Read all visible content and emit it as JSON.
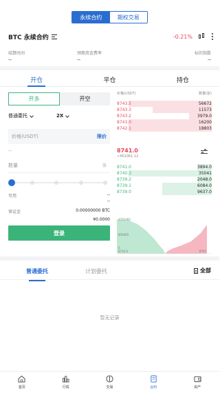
{
  "top_tabs": {
    "perpetual": "永续合约",
    "options": "期权交易"
  },
  "pair": {
    "name": "BTC 永续合约",
    "change": "-0.21%"
  },
  "info": {
    "labels": [
      "结算时间",
      "预期资金费率",
      "标的指数"
    ],
    "values": [
      "--",
      "--",
      "--"
    ]
  },
  "main_tabs": [
    "开仓",
    "平仓",
    "持仓"
  ],
  "trade": {
    "long_label": "开多",
    "short_label": "开空",
    "order_type": "普通委托",
    "leverage": "2X",
    "price_placeholder": "价格(USDT)",
    "limit_label": "限价",
    "approx": "--",
    "qty_placeholder": "数量",
    "qty_unit": "张",
    "slider_percent": 0,
    "available_label": "可用",
    "available_value": "--",
    "available_value2": "--",
    "margin_label": "保证金",
    "margin_value": "0.00000000 BTC",
    "margin_value2": "¥0.0000",
    "login_label": "登录"
  },
  "orderbook": {
    "price_header": "价格(USDT)",
    "qty_header": "数量(张)",
    "asks": [
      {
        "price": "8743.5",
        "qty": "56672",
        "depth": 0.88
      },
      {
        "price": "8743.3",
        "qty": "11573",
        "depth": 0.62
      },
      {
        "price": "8743.2",
        "qty": "3979.0",
        "depth": 0.24
      },
      {
        "price": "8743.0",
        "qty": "16200",
        "depth": 0.88
      },
      {
        "price": "8742.1",
        "qty": "18803",
        "depth": 0.88
      }
    ],
    "last_price": "8741.0",
    "last_sub": "≈¥61061.12",
    "bids": [
      {
        "price": "8741.0",
        "qty": "3894.0",
        "depth": 0.15
      },
      {
        "price": "8740.3",
        "qty": "35041",
        "depth": 0.88
      },
      {
        "price": "8739.2",
        "qty": "2048.0",
        "depth": 0.15
      },
      {
        "price": "8739.1",
        "qty": "6084.0",
        "depth": 0.52
      },
      {
        "price": "8739.0",
        "qty": "9637.0",
        "depth": 0.52
      }
    ],
    "depth_labels": {
      "y_top": "1701082",
      "y_mid": "850405",
      "y_bottom": "0",
      "x_left": "8733.0",
      "x_right": "8701"
    }
  },
  "order_tabs": {
    "normal": "普通委托",
    "plan": "计划委托",
    "all": "全部"
  },
  "empty_text": "暂无记录",
  "bottom_nav": [
    {
      "label": "首页",
      "icon": "home-icon"
    },
    {
      "label": "行情",
      "icon": "market-icon"
    },
    {
      "label": "交易",
      "icon": "trade-icon"
    },
    {
      "label": "合约",
      "icon": "contract-icon"
    },
    {
      "label": "资产",
      "icon": "wallet-icon"
    }
  ],
  "colors": {
    "accent": "#2a6dd0",
    "up": "#3bb47a",
    "down": "#e8485e"
  }
}
